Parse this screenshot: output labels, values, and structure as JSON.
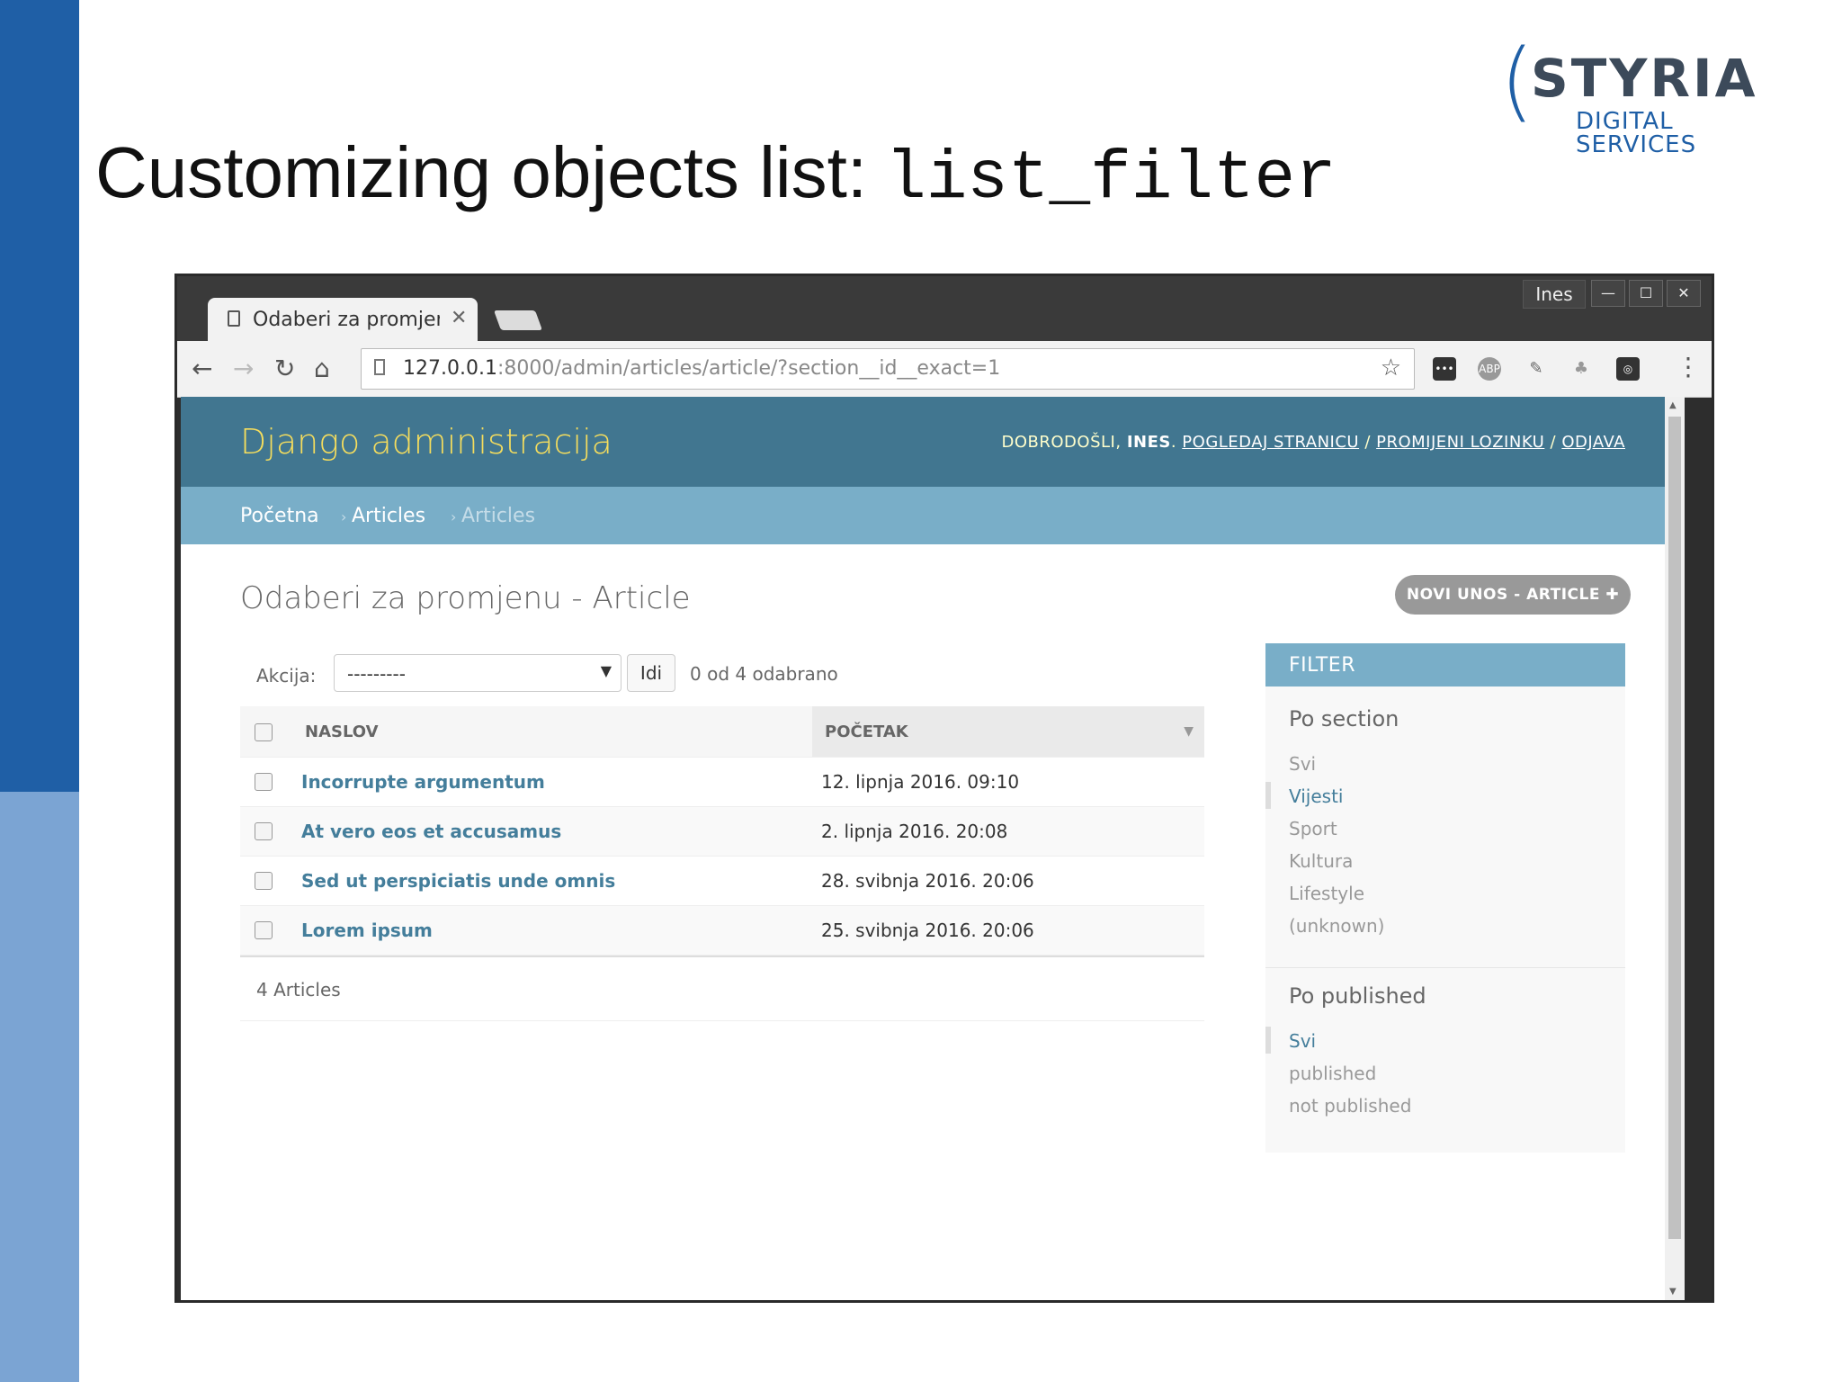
{
  "slide": {
    "title_text": "Customizing objects list:",
    "title_code": "list_filter",
    "logo_main": "STYRIA",
    "logo_sub": "DIGITAL SERVICES"
  },
  "browser": {
    "tab_title": "Odaberi za promjen",
    "user_name": "Ines",
    "url_host": "127.0.0.1",
    "url_rest": ":8000/admin/articles/article/?section__id__exact=1",
    "colors": {
      "chrome_dark": "#3a3a3a",
      "toolbar": "#f2f2f2"
    }
  },
  "admin": {
    "brand": "Django administracija",
    "welcome": "DOBRODOŠLI,",
    "user": "INES",
    "link_view_site": "POGLEDAJ STRANICU",
    "link_change_password": "PROMIJENI LOZINKU",
    "link_logout": "ODJAVA",
    "breadcrumbs": [
      "Početna",
      "Articles",
      "Articles"
    ],
    "page_title": "Odaberi za promjenu - Article",
    "add_button": "NOVI UNOS - ARTICLE",
    "actions": {
      "label": "Akcija:",
      "selected": "---------",
      "go": "Idi",
      "counter": "0 od 4 odabrano"
    },
    "columns": [
      "NASLOV",
      "POČETAK"
    ],
    "rows": [
      {
        "title": "Incorrupte argumentum",
        "start": "12. lipnja 2016. 09:10"
      },
      {
        "title": "At vero eos et accusamus",
        "start": "2. lipnja 2016. 20:08"
      },
      {
        "title": "Sed ut perspiciatis unde omnis",
        "start": "28. svibnja 2016. 20:06"
      },
      {
        "title": "Lorem ipsum",
        "start": "25. svibnja 2016. 20:06"
      }
    ],
    "result_count": "4 Articles",
    "filter": {
      "header": "FILTER",
      "groups": [
        {
          "title": "Po section",
          "options": [
            "Svi",
            "Vijesti",
            "Sport",
            "Kultura",
            "Lifestyle",
            "(unknown)"
          ],
          "selected": "Vijesti"
        },
        {
          "title": "Po published",
          "options": [
            "Svi",
            "published",
            "not published"
          ],
          "selected": "Svi"
        }
      ]
    },
    "colors": {
      "header": "#417690",
      "brand": "#f5dd5d",
      "breadcrumbs": "#79aec8",
      "link": "#447e9b"
    }
  }
}
